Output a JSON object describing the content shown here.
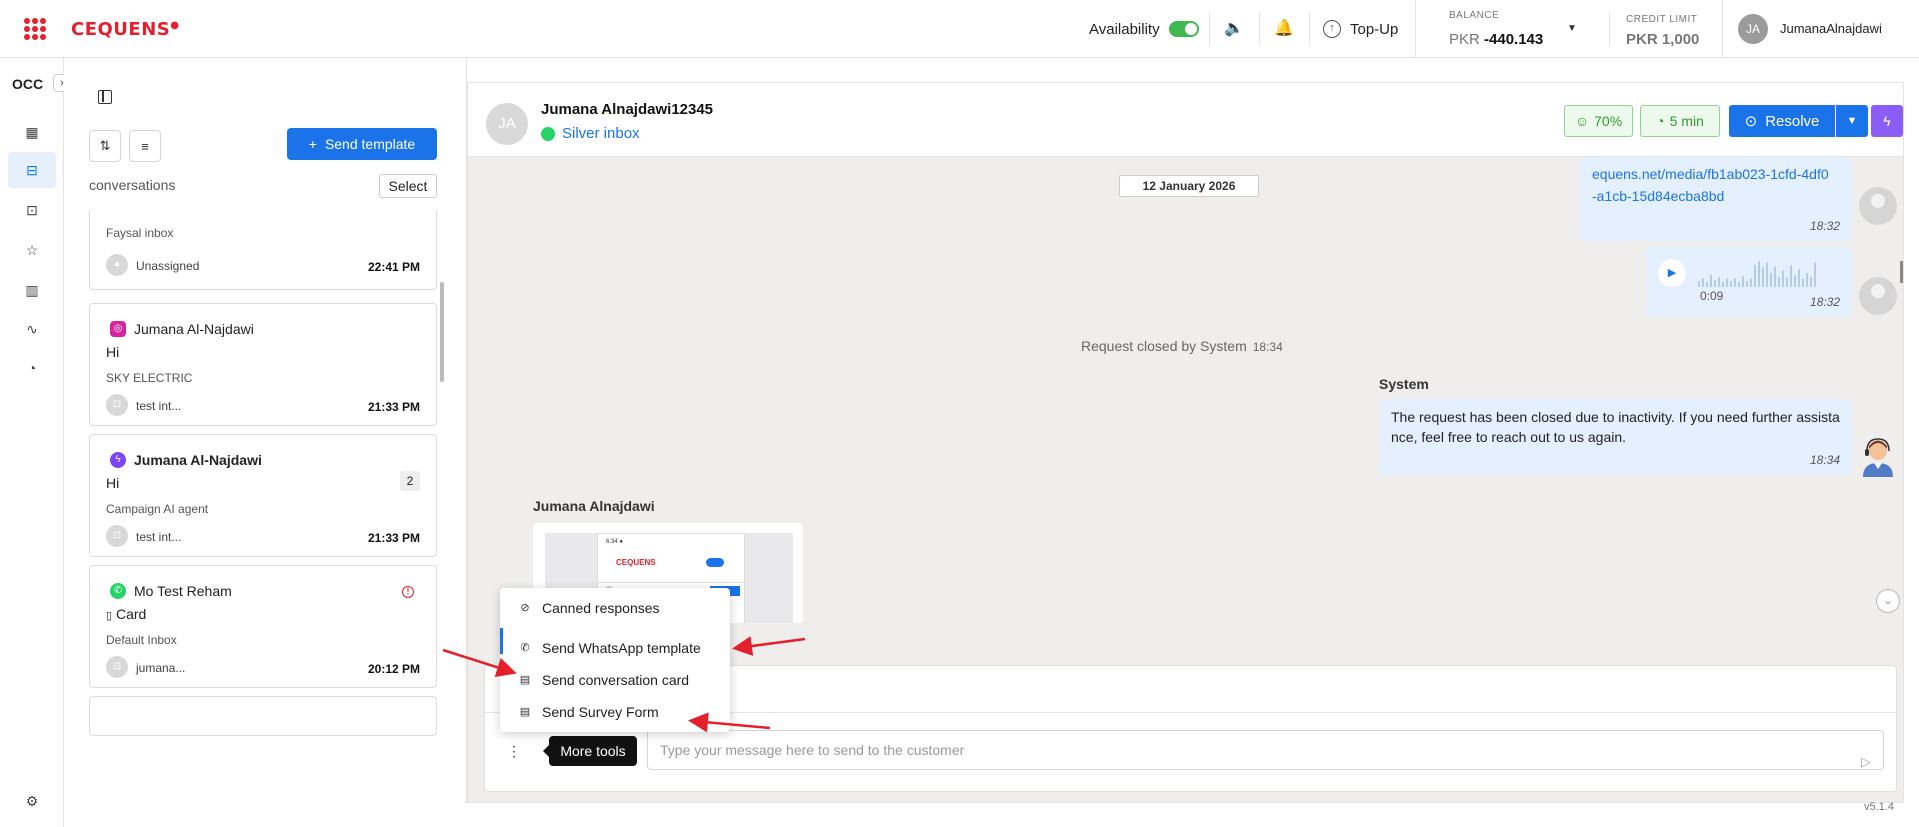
{
  "topbar": {
    "brand": "CEQUENS",
    "availability_label": "Availability",
    "availability_on": true,
    "topup_label": "Top-Up",
    "balance_label": "BALANCE",
    "balance_currency": "PKR",
    "balance_value": "-440.143",
    "credit_label": "CREDIT LIMIT",
    "credit_value": "PKR 1,000",
    "user_initials": "JA",
    "user_name": "JumanaAlnajdawi"
  },
  "rail": {
    "title": "OCC",
    "icons": [
      "dashboard-icon",
      "inbox-icon",
      "bot-icon",
      "star-icon",
      "chart-icon",
      "activity-icon",
      "history-icon"
    ],
    "settings_icon": "gear-icon"
  },
  "conversations": {
    "send_template_label": "Send template",
    "section_label": "conversations",
    "select_label": "Select",
    "cards": [
      {
        "channel": "",
        "name": "",
        "message": "",
        "inbox": "Faysal inbox",
        "agent": "Unassigned",
        "time": "22:41 PM"
      },
      {
        "channel": "instagram",
        "name": "Jumana Al-Najdawi",
        "message": "Hi",
        "inbox": "SKY ELECTRIC",
        "agent": "test int...",
        "time": "21:33 PM"
      },
      {
        "channel": "messenger",
        "name": "Jumana Al-Najdawi",
        "message": "Hi",
        "badge": "2",
        "inbox": "Campaign AI agent",
        "agent": "test int...",
        "time": "21:33 PM"
      },
      {
        "channel": "whatsapp",
        "name": "Mo Test Reham",
        "message": "Card",
        "inbox": "Default Inbox",
        "agent": "jumana...",
        "time": "20:12 PM"
      }
    ]
  },
  "chat": {
    "contact_initials": "JA",
    "contact_name": "Jumana Alnajdawi12345",
    "inbox": "Silver inbox",
    "satisfaction": "70%",
    "response_time": "5 min",
    "resolve_label": "Resolve",
    "date_chip": "12 January 2026",
    "link_message": "equens.net/media/fb1ab023-1cfd-4df0-a1cb-15d84ecba8bd",
    "link_time": "18:32",
    "audio_duration": "0:09",
    "audio_time": "18:32",
    "closed_note": "Request closed by System",
    "closed_time": "18:34",
    "system_name": "System",
    "system_message": "The request has been closed due to inactivity. If you need further assistance, feel free to reach out to us again.",
    "system_time": "18:34",
    "customer_label": "Jumana Alnajdawi",
    "composer_placeholder": "Type your message here to send to the customer",
    "more_tools_tooltip": "More tools"
  },
  "menu": {
    "items": [
      {
        "icon": "canned-response-icon",
        "label": "Canned responses"
      },
      {
        "icon": "whatsapp-icon",
        "label": "Send WhatsApp template"
      },
      {
        "icon": "clipboard-icon",
        "label": "Send conversation card"
      },
      {
        "icon": "clipboard-icon",
        "label": "Send Survey Form"
      }
    ]
  },
  "version": "v5.1.4",
  "colors": {
    "brand": "#e3202b",
    "primary": "#1a73e8",
    "success": "#3fb950",
    "accent_purple": "#8b5cf6",
    "annotation_arrow": "#e3202b"
  }
}
